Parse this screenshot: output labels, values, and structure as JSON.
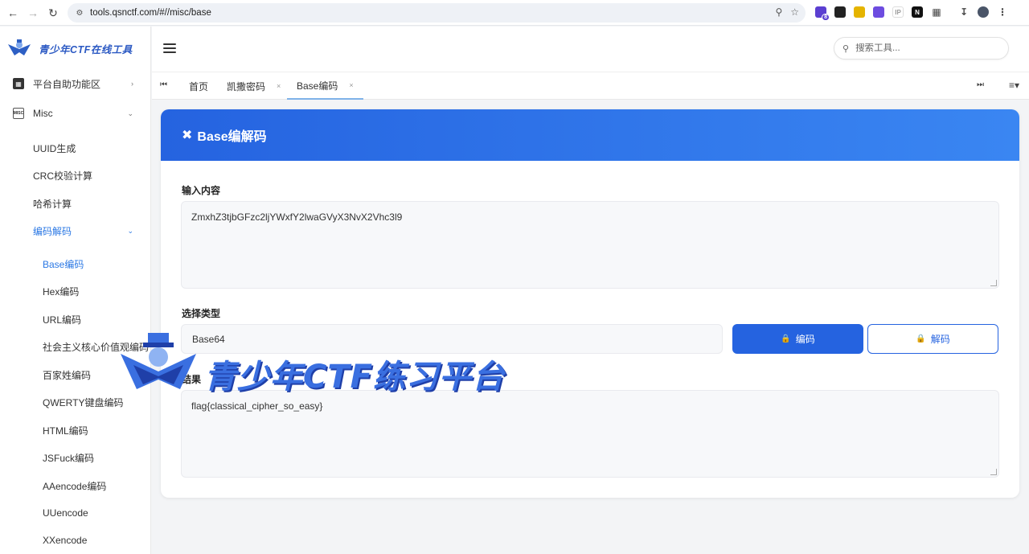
{
  "browser": {
    "url": "tools.qsnctf.com/#//misc/base",
    "ext_badge": "8",
    "ext_ip": "IP",
    "ext_n": "N"
  },
  "brand": {
    "name": "青少年CTF在线工具"
  },
  "sidebar": {
    "items": [
      {
        "label": "平台自助功能区",
        "icon": "platform-icon",
        "expandable": true
      },
      {
        "label": "Misc",
        "icon": "misc-icon",
        "expandable": true
      },
      {
        "label": "UUID生成"
      },
      {
        "label": "CRC校验计算"
      },
      {
        "label": "哈希计算"
      },
      {
        "label": "编码解码",
        "active": true,
        "expandable": true
      },
      {
        "label": "Base编码",
        "active": true
      },
      {
        "label": "Hex编码"
      },
      {
        "label": "URL编码"
      },
      {
        "label": "社会主义核心价值观编码"
      },
      {
        "label": "百家姓编码"
      },
      {
        "label": "QWERTY键盘编码"
      },
      {
        "label": "HTML编码"
      },
      {
        "label": "JSFuck编码"
      },
      {
        "label": "AAencode编码"
      },
      {
        "label": "UUencode"
      },
      {
        "label": "XXencode"
      }
    ]
  },
  "search": {
    "placeholder": "搜索工具..."
  },
  "tabs": [
    {
      "label": "首页",
      "closable": false
    },
    {
      "label": "凯撒密码",
      "closable": true
    },
    {
      "label": "Base编码",
      "closable": true,
      "active": true
    }
  ],
  "card": {
    "title": "Base编解码",
    "input_label": "输入内容",
    "input_value": "ZmxhZ3tjbGFzc2ljYWxfY2lwaGVyX3NvX2Vhc3l9",
    "type_label": "选择类型",
    "type_value": "Base64",
    "encode_label": "编码",
    "decode_label": "解码",
    "result_label": "结果",
    "result_value": "flag{classical_cipher_so_easy}"
  },
  "watermark": {
    "text": "青少年CTF练习平台"
  },
  "colors": {
    "accent": "#2563e0",
    "header_end": "#3a86f2",
    "active_link": "#2b78e4"
  }
}
